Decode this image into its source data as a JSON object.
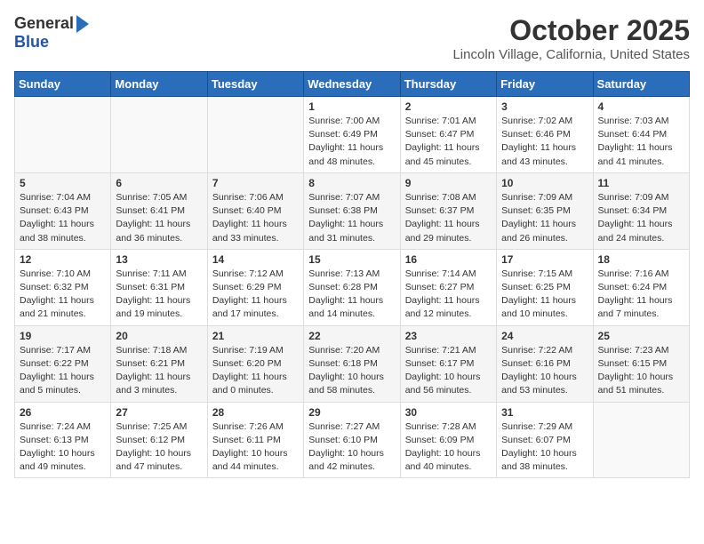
{
  "header": {
    "logo_general": "General",
    "logo_blue": "Blue",
    "month_title": "October 2025",
    "location": "Lincoln Village, California, United States"
  },
  "days_of_week": [
    "Sunday",
    "Monday",
    "Tuesday",
    "Wednesday",
    "Thursday",
    "Friday",
    "Saturday"
  ],
  "weeks": [
    [
      {
        "day": "",
        "info": ""
      },
      {
        "day": "",
        "info": ""
      },
      {
        "day": "",
        "info": ""
      },
      {
        "day": "1",
        "info": "Sunrise: 7:00 AM\nSunset: 6:49 PM\nDaylight: 11 hours and 48 minutes."
      },
      {
        "day": "2",
        "info": "Sunrise: 7:01 AM\nSunset: 6:47 PM\nDaylight: 11 hours and 45 minutes."
      },
      {
        "day": "3",
        "info": "Sunrise: 7:02 AM\nSunset: 6:46 PM\nDaylight: 11 hours and 43 minutes."
      },
      {
        "day": "4",
        "info": "Sunrise: 7:03 AM\nSunset: 6:44 PM\nDaylight: 11 hours and 41 minutes."
      }
    ],
    [
      {
        "day": "5",
        "info": "Sunrise: 7:04 AM\nSunset: 6:43 PM\nDaylight: 11 hours and 38 minutes."
      },
      {
        "day": "6",
        "info": "Sunrise: 7:05 AM\nSunset: 6:41 PM\nDaylight: 11 hours and 36 minutes."
      },
      {
        "day": "7",
        "info": "Sunrise: 7:06 AM\nSunset: 6:40 PM\nDaylight: 11 hours and 33 minutes."
      },
      {
        "day": "8",
        "info": "Sunrise: 7:07 AM\nSunset: 6:38 PM\nDaylight: 11 hours and 31 minutes."
      },
      {
        "day": "9",
        "info": "Sunrise: 7:08 AM\nSunset: 6:37 PM\nDaylight: 11 hours and 29 minutes."
      },
      {
        "day": "10",
        "info": "Sunrise: 7:09 AM\nSunset: 6:35 PM\nDaylight: 11 hours and 26 minutes."
      },
      {
        "day": "11",
        "info": "Sunrise: 7:09 AM\nSunset: 6:34 PM\nDaylight: 11 hours and 24 minutes."
      }
    ],
    [
      {
        "day": "12",
        "info": "Sunrise: 7:10 AM\nSunset: 6:32 PM\nDaylight: 11 hours and 21 minutes."
      },
      {
        "day": "13",
        "info": "Sunrise: 7:11 AM\nSunset: 6:31 PM\nDaylight: 11 hours and 19 minutes."
      },
      {
        "day": "14",
        "info": "Sunrise: 7:12 AM\nSunset: 6:29 PM\nDaylight: 11 hours and 17 minutes."
      },
      {
        "day": "15",
        "info": "Sunrise: 7:13 AM\nSunset: 6:28 PM\nDaylight: 11 hours and 14 minutes."
      },
      {
        "day": "16",
        "info": "Sunrise: 7:14 AM\nSunset: 6:27 PM\nDaylight: 11 hours and 12 minutes."
      },
      {
        "day": "17",
        "info": "Sunrise: 7:15 AM\nSunset: 6:25 PM\nDaylight: 11 hours and 10 minutes."
      },
      {
        "day": "18",
        "info": "Sunrise: 7:16 AM\nSunset: 6:24 PM\nDaylight: 11 hours and 7 minutes."
      }
    ],
    [
      {
        "day": "19",
        "info": "Sunrise: 7:17 AM\nSunset: 6:22 PM\nDaylight: 11 hours and 5 minutes."
      },
      {
        "day": "20",
        "info": "Sunrise: 7:18 AM\nSunset: 6:21 PM\nDaylight: 11 hours and 3 minutes."
      },
      {
        "day": "21",
        "info": "Sunrise: 7:19 AM\nSunset: 6:20 PM\nDaylight: 11 hours and 0 minutes."
      },
      {
        "day": "22",
        "info": "Sunrise: 7:20 AM\nSunset: 6:18 PM\nDaylight: 10 hours and 58 minutes."
      },
      {
        "day": "23",
        "info": "Sunrise: 7:21 AM\nSunset: 6:17 PM\nDaylight: 10 hours and 56 minutes."
      },
      {
        "day": "24",
        "info": "Sunrise: 7:22 AM\nSunset: 6:16 PM\nDaylight: 10 hours and 53 minutes."
      },
      {
        "day": "25",
        "info": "Sunrise: 7:23 AM\nSunset: 6:15 PM\nDaylight: 10 hours and 51 minutes."
      }
    ],
    [
      {
        "day": "26",
        "info": "Sunrise: 7:24 AM\nSunset: 6:13 PM\nDaylight: 10 hours and 49 minutes."
      },
      {
        "day": "27",
        "info": "Sunrise: 7:25 AM\nSunset: 6:12 PM\nDaylight: 10 hours and 47 minutes."
      },
      {
        "day": "28",
        "info": "Sunrise: 7:26 AM\nSunset: 6:11 PM\nDaylight: 10 hours and 44 minutes."
      },
      {
        "day": "29",
        "info": "Sunrise: 7:27 AM\nSunset: 6:10 PM\nDaylight: 10 hours and 42 minutes."
      },
      {
        "day": "30",
        "info": "Sunrise: 7:28 AM\nSunset: 6:09 PM\nDaylight: 10 hours and 40 minutes."
      },
      {
        "day": "31",
        "info": "Sunrise: 7:29 AM\nSunset: 6:07 PM\nDaylight: 10 hours and 38 minutes."
      },
      {
        "day": "",
        "info": ""
      }
    ]
  ]
}
